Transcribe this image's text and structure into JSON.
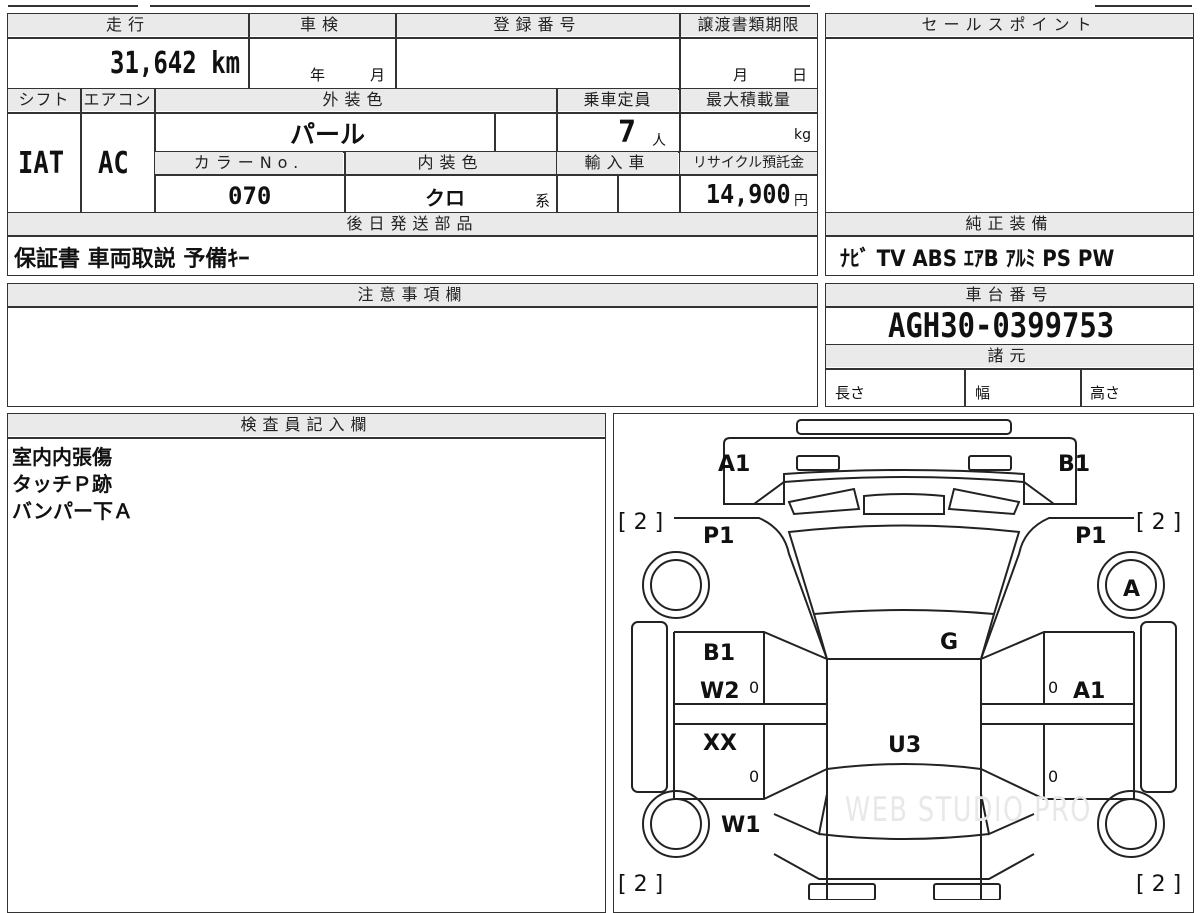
{
  "header": {
    "mileage_label": "走行",
    "inspection_label": "車検",
    "registration_label": "登録番号",
    "transfer_label": "譲渡書類期限",
    "sale_points_label": "セールスポイント"
  },
  "mileage": "31,642 km",
  "inspection": {
    "year_unit": "年",
    "month_unit": "月"
  },
  "transfer": {
    "month_unit": "月",
    "day_unit": "日"
  },
  "row2": {
    "shift_label": "シフト",
    "ac_label": "エアコン",
    "exterior_label": "外装色",
    "capacity_label": "乗車定員",
    "maxload_label": "最大積載量"
  },
  "shift": "IAT",
  "ac": "AC",
  "exterior_color": "パール",
  "capacity": "7",
  "capacity_unit": "人",
  "maxload_unit": "kg",
  "row3": {
    "color_no_label": "カラーNo.",
    "interior_label": "内装色",
    "import_label": "輸入車",
    "recycle_label": "リサイクル預託金"
  },
  "color_no": "070",
  "interior_color": "クロ",
  "interior_suffix": "系",
  "recycle_fee": "14,900",
  "recycle_unit": "円",
  "later_parts": {
    "label": "後日発送部品",
    "value": "保証書 車両取説 予備ｷｰ"
  },
  "genuine_equipment": {
    "label": "純正装備",
    "value": "ﾅﾋﾞ TV ABS ｴｱB ｱﾙﾐ PS PW"
  },
  "notes": {
    "label": "注意事項欄"
  },
  "chassis": {
    "label": "車台番号",
    "value": "AGH30-0399753"
  },
  "specs": {
    "label": "諸元",
    "length": "長さ",
    "width": "幅",
    "height": "高さ"
  },
  "inspector": {
    "label": "検査員記入欄",
    "lines": [
      "室内内張傷",
      "タッチＰ跡",
      "バンパー下Ａ"
    ]
  },
  "diagram": {
    "marks": [
      "A1",
      "B1",
      "P1",
      "P1",
      "A",
      "G",
      "B1",
      "W2",
      "A1",
      "XX",
      "U3",
      "W1"
    ],
    "tire_marks": [
      "[ 2 ]",
      "[ 2 ]",
      "[ 2 ]",
      "[ 2 ]"
    ],
    "zeros": [
      "0",
      "0",
      "0",
      "0"
    ],
    "watermark": "WEB STUDIO PRO"
  }
}
